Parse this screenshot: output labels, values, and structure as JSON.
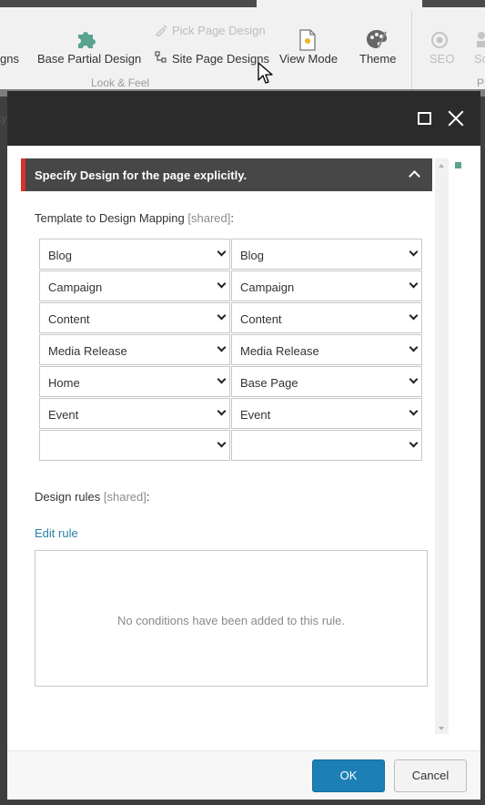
{
  "ribbon": {
    "items": [
      {
        "label": "gns"
      },
      {
        "label": "Base Partial Design"
      },
      {
        "label": "Pick Page Design"
      },
      {
        "label": "Site Page Designs"
      },
      {
        "label": "View Mode"
      },
      {
        "label": "Theme"
      },
      {
        "label": "SEO"
      },
      {
        "label": "Sc"
      }
    ],
    "group_label": "Look & Feel",
    "group_label_right": "P",
    "left_edge_text": "ay"
  },
  "dialog": {
    "section_title": "Specify Design for the page explicitly.",
    "mapping_label": "Template to Design Mapping",
    "shared_tag": "[shared]",
    "mapping_rows": [
      {
        "template": "Blog",
        "design": "Blog"
      },
      {
        "template": "Campaign",
        "design": "Campaign"
      },
      {
        "template": "Content",
        "design": "Content"
      },
      {
        "template": "Media Release",
        "design": "Media Release"
      },
      {
        "template": "Home",
        "design": "Base Page"
      },
      {
        "template": "Event",
        "design": "Event"
      },
      {
        "template": "",
        "design": ""
      }
    ],
    "rules_label": "Design rules",
    "edit_rule_label": "Edit rule",
    "rules_empty_text": "No conditions have been added to this rule.",
    "ok_label": "OK",
    "cancel_label": "Cancel"
  },
  "colors": {
    "accent_red": "#d9302b",
    "primary_button": "#1c7fb5",
    "link": "#2b7fa8",
    "header": "#2b2b2b"
  }
}
